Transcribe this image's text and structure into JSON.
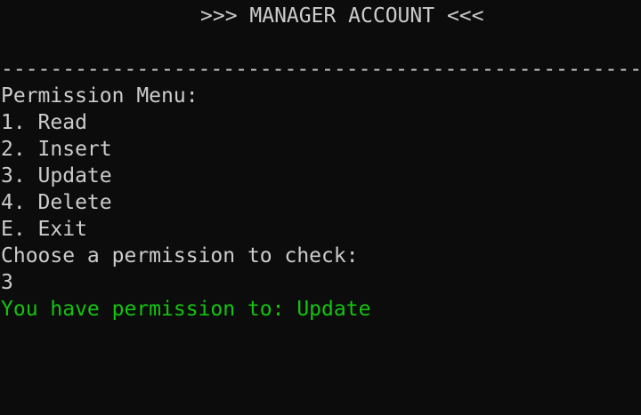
{
  "terminal": {
    "header": ">>> MANAGER ACCOUNT <<<",
    "separator": "-----------------------------------------------------",
    "menu_title": "Permission Menu:",
    "menu_items": [
      "1. Read",
      "2. Insert",
      "3. Update",
      "4. Delete",
      "E. Exit"
    ],
    "prompt": "Choose a permission to check:",
    "user_input": "3",
    "result": "You have permission to: Update",
    "colors": {
      "background": "#0c0c0c",
      "text": "#cccccc",
      "success": "#13c40f"
    }
  }
}
